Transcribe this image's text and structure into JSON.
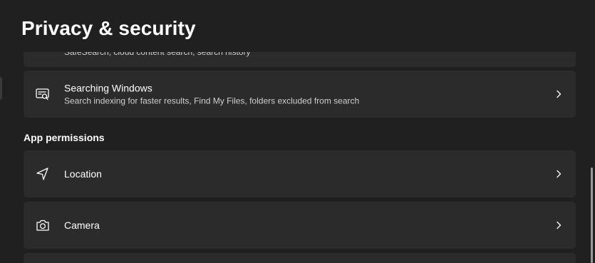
{
  "header": {
    "title": "Privacy & security"
  },
  "cards": {
    "safe_search": {
      "description": "SafeSearch, cloud content search, search history"
    },
    "searching_windows": {
      "label": "Searching Windows",
      "description": "Search indexing for faster results, Find My Files, folders excluded from search",
      "icon": "search-window-icon"
    },
    "location": {
      "label": "Location",
      "icon": "location-arrow-icon"
    },
    "camera": {
      "label": "Camera",
      "icon": "camera-icon"
    }
  },
  "sections": {
    "app_permissions": "App permissions"
  },
  "colors": {
    "background": "#202020",
    "card": "#2b2b2b",
    "text": "#ffffff",
    "secondary_text": "#cfcfcf"
  }
}
